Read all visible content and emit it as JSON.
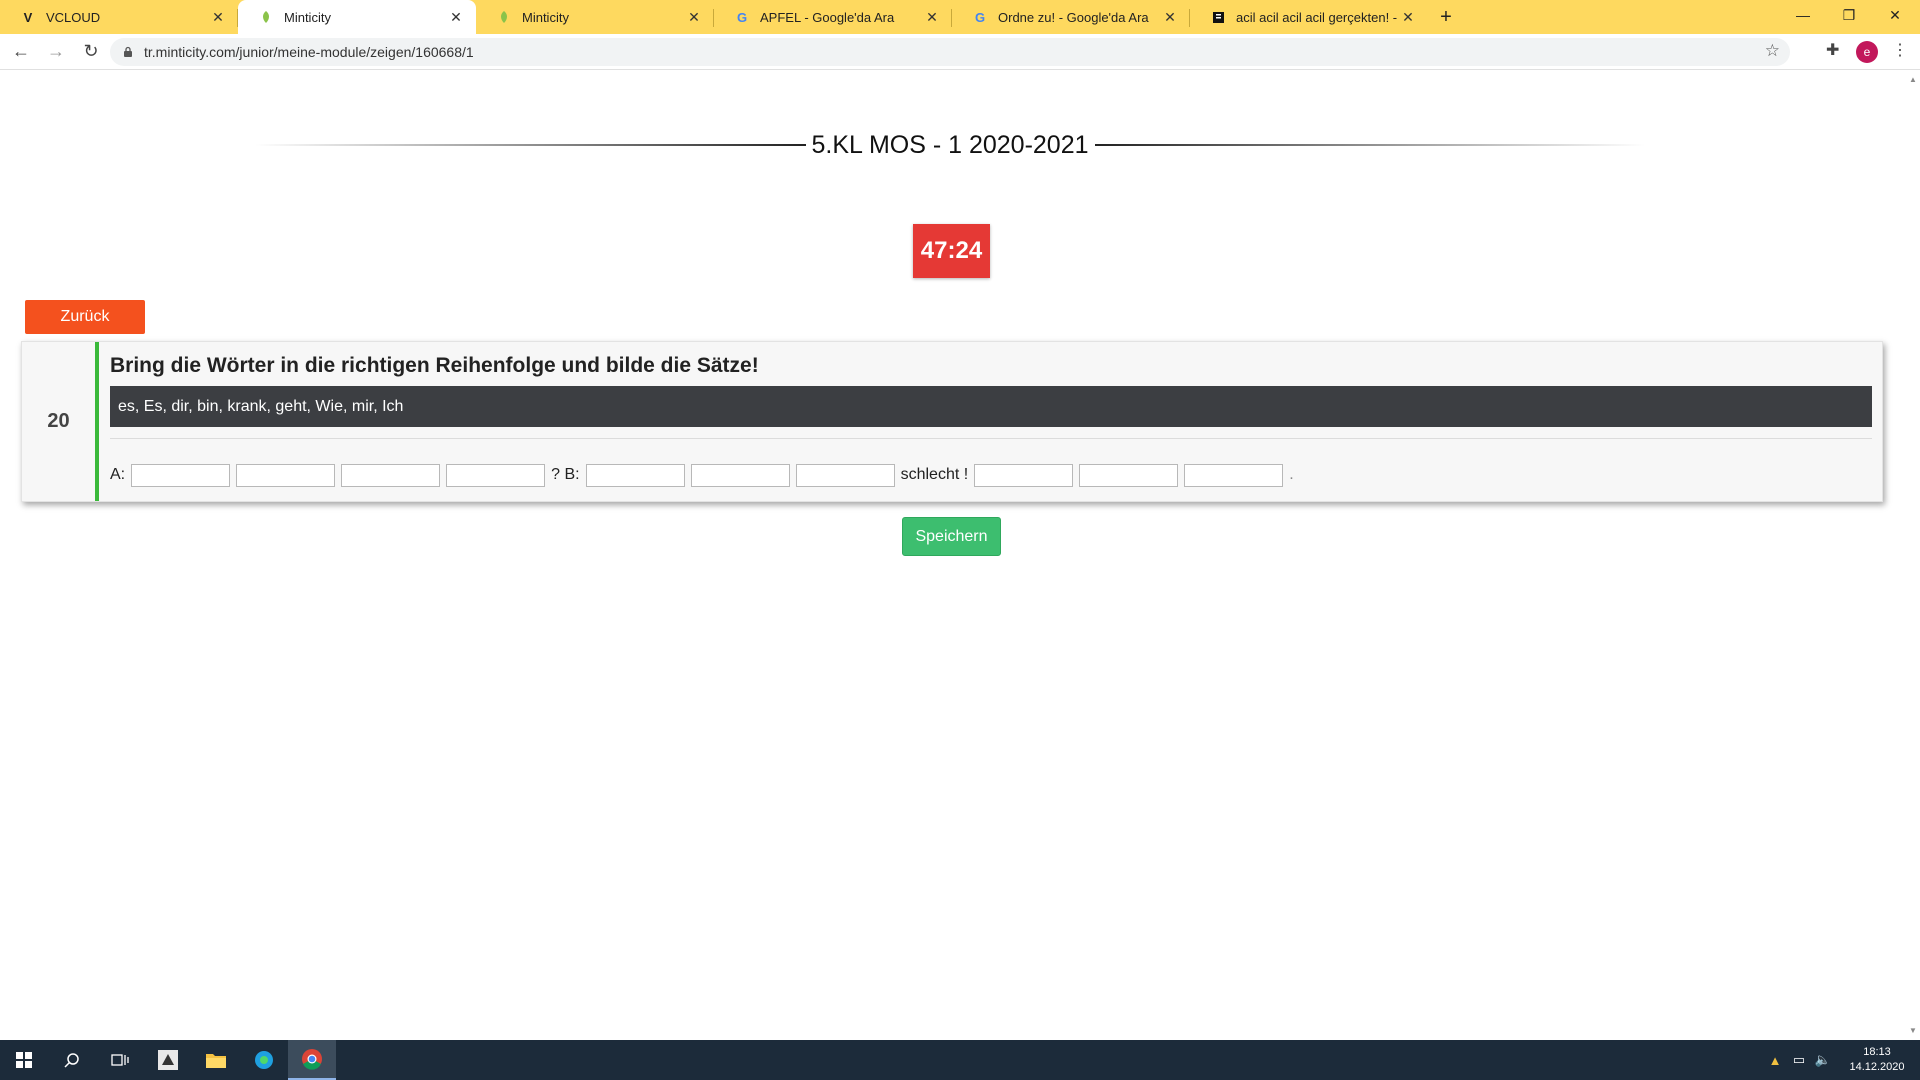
{
  "browser": {
    "tabs": [
      {
        "title": "VCLOUD",
        "favicon": "V",
        "active": false
      },
      {
        "title": "Minticity",
        "favicon": "leaf-icon",
        "active": true
      },
      {
        "title": "Minticity",
        "favicon": "leaf-icon",
        "active": false
      },
      {
        "title": "APFEL - Google'da Ara",
        "favicon": "google-icon",
        "active": false
      },
      {
        "title": "Ordne zu! - Google'da Ara",
        "favicon": "google-icon",
        "active": false
      },
      {
        "title": "acil acil acil acil gerçekten! - Eodev",
        "favicon": "book-icon",
        "active": false
      }
    ],
    "url": "tr.minticity.com/junior/meine-module/zeigen/160668/1",
    "profile_initial": "e",
    "accent": "#fed95f"
  },
  "page": {
    "heading": "5.KL MOS - 1 2020-2021",
    "timer": "47:24",
    "back_label": "Zurück",
    "save_label": "Speichern",
    "question": {
      "number": "20",
      "title": "Bring die Wörter in die richtigen Reihenfolge und bilde die Sätze!",
      "words": "es, Es, dir, bin, krank, geht, Wie, mir, Ich",
      "answer": {
        "prefix_a": "A:",
        "mid_1": "? B:",
        "mid_2": "schlecht !",
        "suffix": ".",
        "inputs": [
          "",
          "",
          "",
          "",
          "",
          "",
          "",
          "",
          "",
          ""
        ]
      }
    },
    "colors": {
      "timer": "#e53935",
      "back": "#f4511e",
      "save": "#3dbe6f",
      "accent_bar": "#3ab93a",
      "words_bg": "#3c3e42"
    }
  },
  "taskbar": {
    "time": "18:13",
    "date": "14.12.2020"
  }
}
